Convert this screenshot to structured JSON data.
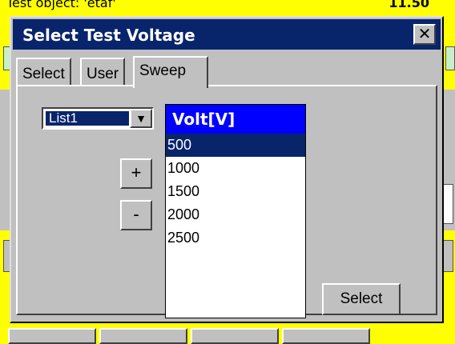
{
  "background": {
    "title_left": "Test object: 'etaf'",
    "title_right": "11.50"
  },
  "dialog": {
    "title": "Select Test Voltage",
    "close_glyph": "✕",
    "tabs": [
      {
        "label": "Select"
      },
      {
        "label": "User"
      },
      {
        "label": "Sweep"
      }
    ],
    "active_tab": "Sweep",
    "list_selector": {
      "value": "List1",
      "arrow_glyph": "▼"
    },
    "plus_label": "+",
    "minus_label": "-",
    "voltage_list": {
      "header": "Volt[V]",
      "items": [
        "500",
        "1000",
        "1500",
        "2000",
        "2500"
      ],
      "selected": "500"
    },
    "select_button": "Select"
  },
  "colors": {
    "background": "#ffff00",
    "titlebar": "#08246b",
    "list_header": "#0000ff",
    "dialog_face": "#c0c0c0"
  }
}
